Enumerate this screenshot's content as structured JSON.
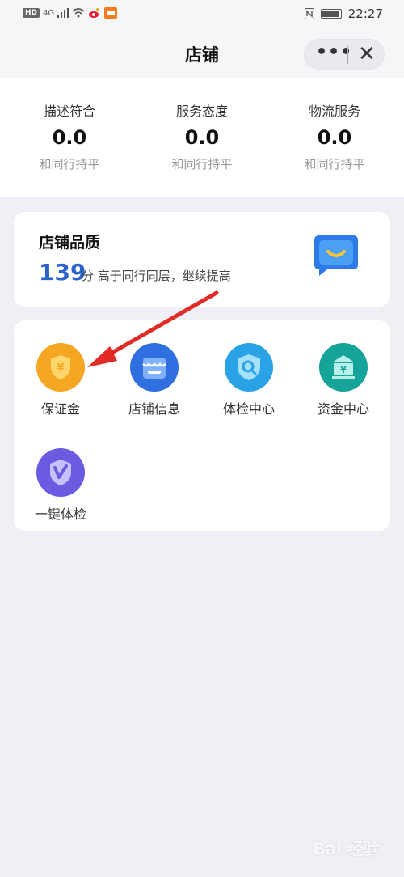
{
  "status_bar": {
    "left_badges": [
      "HD",
      "4G"
    ],
    "time": "22:27"
  },
  "header": {
    "title": "店铺",
    "more_label": "•••",
    "close_label": "✕"
  },
  "ratings": [
    {
      "label": "描述符合",
      "value": "0.0",
      "sub": "和同行持平"
    },
    {
      "label": "服务态度",
      "value": "0.0",
      "sub": "和同行持平"
    },
    {
      "label": "物流服务",
      "value": "0.0",
      "sub": "和同行持平"
    }
  ],
  "quality": {
    "title": "店铺品质",
    "score": "139",
    "desc": "分 高于同行同层，继续提高"
  },
  "services": [
    {
      "label": "保证金",
      "icon": "shield-yuan-icon",
      "color": "#f5a623"
    },
    {
      "label": "店铺信息",
      "icon": "store-icon",
      "color": "#2f6fe0"
    },
    {
      "label": "体检中心",
      "icon": "search-shield-icon",
      "color": "#29a3e6"
    },
    {
      "label": "资金中心",
      "icon": "bank-icon",
      "color": "#16a39a"
    },
    {
      "label": "一键体检",
      "icon": "check-shield-icon",
      "color": "#6a5be0"
    }
  ],
  "annotation_color": "#e02b26",
  "watermark": "Bai 经验"
}
